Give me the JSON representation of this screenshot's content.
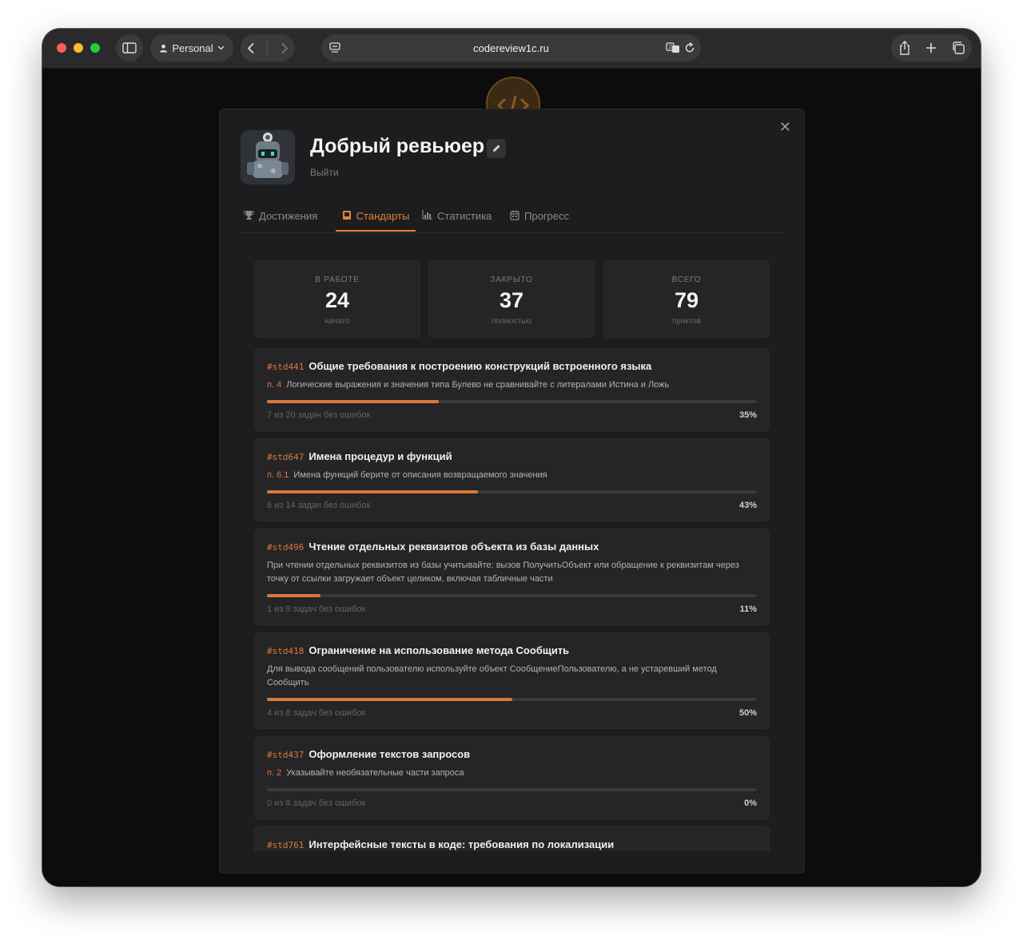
{
  "browser": {
    "profile_label": "Personal",
    "url": "codereview1c.ru"
  },
  "profile": {
    "name": "Добрый ревьюер",
    "logout_label": "Выйти"
  },
  "tabs": [
    {
      "label": "Достижения",
      "icon": "trophy-icon",
      "active": false
    },
    {
      "label": "Стандарты",
      "icon": "book-icon",
      "active": true
    },
    {
      "label": "Статистика",
      "icon": "bar-chart-icon",
      "active": false
    },
    {
      "label": "Прогресс",
      "icon": "calendar-icon",
      "active": false
    }
  ],
  "stats": [
    {
      "label": "В РАБОТЕ",
      "value": "24",
      "sub": "начато"
    },
    {
      "label": "ЗАКРЫТО",
      "value": "37",
      "sub": "полностью"
    },
    {
      "label": "ВСЕГО",
      "value": "79",
      "sub": "пунктов"
    }
  ],
  "standards": [
    {
      "tag": "#std441",
      "title": "Общие требования к построению конструкций встроенного языка",
      "point": "п. 4",
      "desc": "Логические выражения и значения типа Булево не сравнивайте с литералами Истина и Ложь",
      "progress": "7 из 20 задач без ошибок",
      "percent": "35%",
      "fraction": 0.35
    },
    {
      "tag": "#std647",
      "title": "Имена процедур и функций",
      "point": "п. 6.1",
      "desc": "Имена функций берите от описания возвращаемого значения",
      "progress": "6 из 14 задач без ошибок",
      "percent": "43%",
      "fraction": 0.43
    },
    {
      "tag": "#std496",
      "title": "Чтение отдельных реквизитов объекта из базы данных",
      "point": "",
      "desc": "При чтении отдельных реквизитов из базы учитывайте: вызов ПолучитьОбъект или обращение к реквизитам через точку от ссылки загружает объект целиком, включая табличные части",
      "progress": "1 из 9 задач без ошибок",
      "percent": "11%",
      "fraction": 0.11
    },
    {
      "tag": "#std418",
      "title": "Ограничение на использование метода Сообщить",
      "point": "",
      "desc": "Для вывода сообщений пользователю используйте объект СообщениеПользователю, а не устаревший метод Сообщить",
      "progress": "4 из 8 задач без ошибок",
      "percent": "50%",
      "fraction": 0.5
    },
    {
      "tag": "#std437",
      "title": "Оформление текстов запросов",
      "point": "п. 2",
      "desc": "Указывайте необязательные части запроса",
      "progress": "0 из 8 задач без ошибок",
      "percent": "0%",
      "fraction": 0.0
    },
    {
      "tag": "#std761",
      "title": "Интерфейсные тексты в коде: требования по локализации",
      "point": "",
      "desc": "",
      "progress": "",
      "percent": "",
      "fraction": 0.0
    }
  ]
}
